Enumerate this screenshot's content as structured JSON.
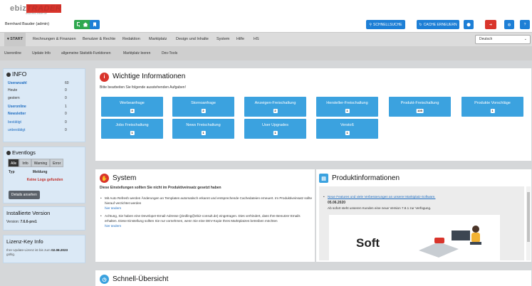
{
  "header": {
    "logo_left": "ebiz",
    "logo_right": "TRADER",
    "logo_url": "www.ebiz-trader.de",
    "username": "Bernhard Bauder (admin)",
    "quicksearch_label": "SCHNELLSUCHE",
    "cache_label": "CACHE ERNEUERN"
  },
  "nav": {
    "items": [
      "START",
      "Rechnungen & Finanzen",
      "Benutzer & Rechte",
      "Redaktion",
      "Marktplatz",
      "Design und Inhalte",
      "System",
      "Hilfe",
      "HS"
    ],
    "language": "Deutsch"
  },
  "subnav": {
    "items": [
      "Useronline",
      "Update Info",
      "allgemeine Statistik-Funktionen",
      "Marktplatz leeren",
      "Dev-Tools"
    ]
  },
  "info": {
    "title": "INFO",
    "rows": [
      {
        "label": "Useranzahl",
        "value": "60"
      },
      {
        "label": "Heute",
        "value": "0"
      },
      {
        "label": "gestern",
        "value": "0"
      },
      {
        "label": "Useronline",
        "value": "1"
      },
      {
        "label": "Newsletter",
        "value": "0"
      },
      {
        "label": "bestätigt",
        "value": "0"
      },
      {
        "label": "unbestätigt",
        "value": "0"
      }
    ]
  },
  "eventlogs": {
    "title": "Eventlogs",
    "tabs": [
      "Alle",
      "Info",
      "Warning",
      "Error"
    ],
    "col_type": "Typ",
    "col_message": "Meldung",
    "empty": "Keine Logs gefunden",
    "details_button": "Details ansehen"
  },
  "version": {
    "title": "Installierte Version",
    "label": "Version:",
    "value": "7.6.6-pre1"
  },
  "license": {
    "title": "Lizenz-Key Info",
    "text_before": "Ihre Update-Lizenz ist bis zum",
    "date": "02.08.2023",
    "text_after": "gültig."
  },
  "important": {
    "title": "Wichtige Informationen",
    "subtitle": "Bitte bearbeiten Sie folgende ausstehenden Aufgaben!",
    "tiles": [
      {
        "label": "Werbeanfrage",
        "count": "3"
      },
      {
        "label": "Stornoanfrage",
        "count": "2"
      },
      {
        "label": "Anzeigen-Freischaltung",
        "count": "2"
      },
      {
        "label": "Hersteller-Freischaltung",
        "count": "1"
      },
      {
        "label": "Produkt-Freischaltung",
        "count": "105"
      },
      {
        "label": "Produkte Vorschläge",
        "count": "1"
      },
      {
        "label": "Jobs Freischaltung",
        "count": "1"
      },
      {
        "label": "News Freischaltung",
        "count": "1"
      },
      {
        "label": "User Upgrades",
        "count": "1"
      },
      {
        "label": "Verstoß",
        "count": "1"
      }
    ]
  },
  "system": {
    "title": "System",
    "warning": "Diese Einstellungen sollten Sie nicht im Produktiveinsatz gesetzt haben",
    "item1": "Mit Auto Refresh werden Änderungen an Templates automatisch erkannt und entsprechende Cachedateien erneuert. Im Produktiveinsatz sollte hierauf verzichtet werden",
    "item1_link": "hier ändern",
    "item2": "Achtung, Sie haben eine Developer-Email-Adresse (jriedling@ebiz-consult.de) eingetragen. Dies verhindert, dass Ihre Benutzer Emails erhalten. Diese Einstellung sollten Sie nur vornehmen, wenn Sie eine DEV-Kopie Ihres Marktplatzes betreiben möchten",
    "item2_link": "hier ändern"
  },
  "product_info": {
    "title": "Produktinformationen",
    "news_link": "Neue Features und viele Verbesserungen an unserer Marktplatz-Software.",
    "date": "05.06.2020",
    "text": "Ab sofort steht unseren Kunden eine neue Version 7.8.1 zur Verfügung.",
    "teaser_word": "Soft"
  },
  "quick": {
    "title": "Schnell-Übersicht"
  },
  "colors": {
    "tile": "#3ba2df",
    "link": "#1d6cc0",
    "green": "#2fa84f",
    "blue": "#1d7fd6",
    "red": "#d9342b"
  }
}
